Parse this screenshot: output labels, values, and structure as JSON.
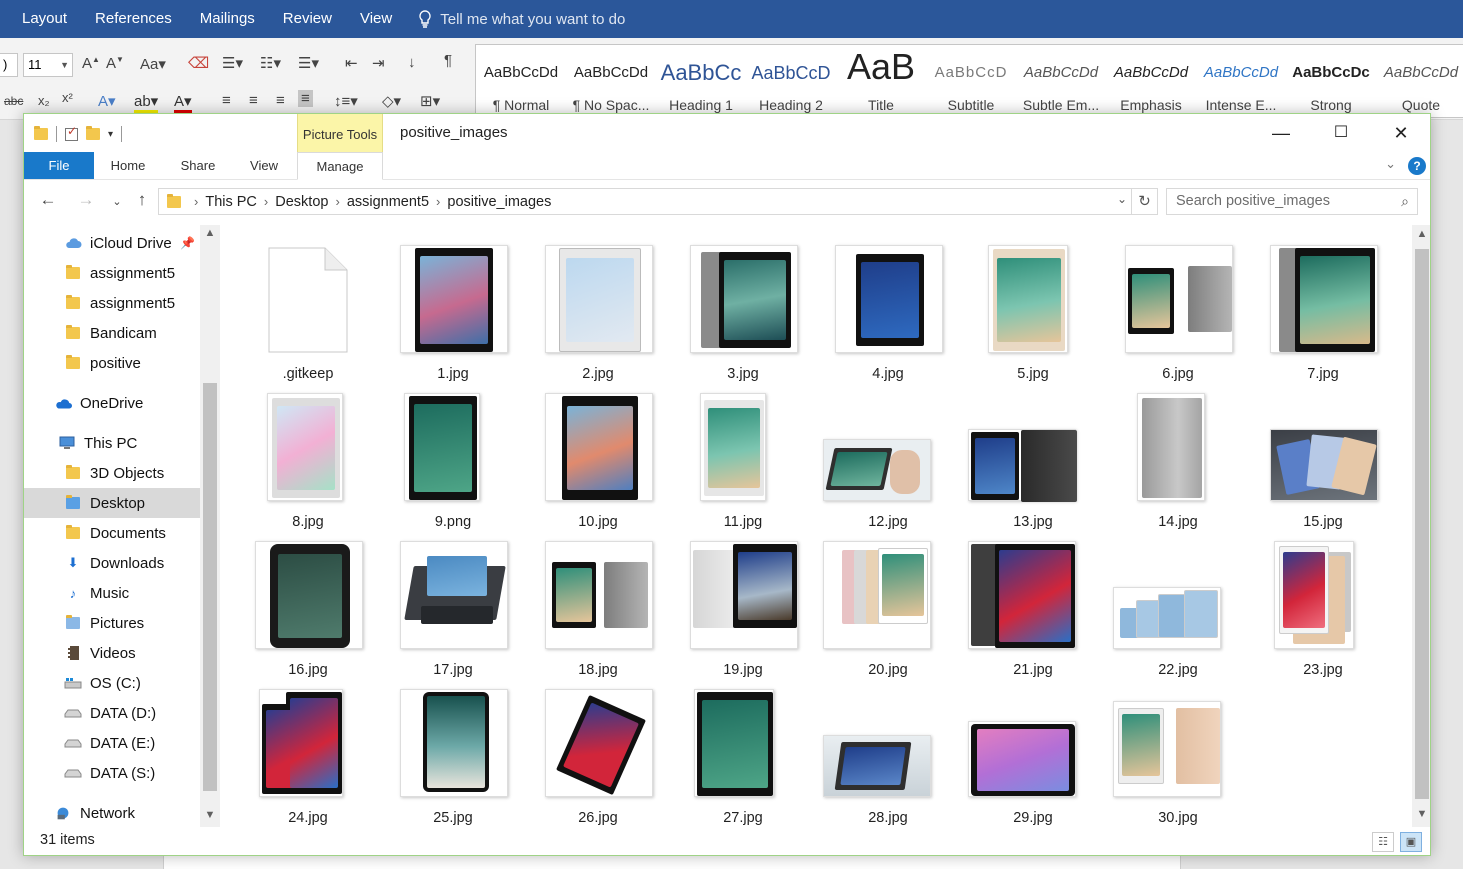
{
  "word": {
    "tabs": [
      "Layout",
      "References",
      "Mailings",
      "Review",
      "View"
    ],
    "tell_me": "Tell me what you want to do",
    "font_name": ")",
    "font_size": "11",
    "styles": [
      {
        "sample": "AaBbCcDd",
        "name": "¶ Normal"
      },
      {
        "sample": "AaBbCcDd",
        "name": "¶ No Spac..."
      },
      {
        "sample": "AaBbCc",
        "name": "Heading 1"
      },
      {
        "sample": "AaBbCcD",
        "name": "Heading 2"
      },
      {
        "sample": "AaB",
        "name": "Title"
      },
      {
        "sample": "AaBbCcD",
        "name": "Subtitle"
      },
      {
        "sample": "AaBbCcDd",
        "name": "Subtle Em..."
      },
      {
        "sample": "AaBbCcDd",
        "name": "Emphasis"
      },
      {
        "sample": "AaBbCcDd",
        "name": "Intense E..."
      },
      {
        "sample": "AaBbCcDc",
        "name": "Strong"
      },
      {
        "sample": "AaBbCcDd",
        "name": "Quote"
      }
    ]
  },
  "explorer": {
    "title": "positive_images",
    "context_tab": "Picture Tools",
    "ribbon_tabs": [
      "File",
      "Home",
      "Share",
      "View",
      "Manage"
    ],
    "window_controls": {
      "minimize": "—",
      "maximize": "☐",
      "close": "✕"
    },
    "breadcrumb": [
      "This PC",
      "Desktop",
      "assignment5",
      "positive_images"
    ],
    "search_placeholder": "Search positive_images",
    "sidebar": [
      {
        "label": "iCloud Drive",
        "icon": "cloud-icon",
        "pinned": true
      },
      {
        "label": "assignment5",
        "icon": "folder-icon"
      },
      {
        "label": "assignment5",
        "icon": "folder-icon"
      },
      {
        "label": "Bandicam",
        "icon": "folder-icon"
      },
      {
        "label": "positive",
        "icon": "folder-icon"
      },
      {
        "label": "OneDrive",
        "icon": "onedrive-icon"
      },
      {
        "label": "This PC",
        "icon": "computer-icon"
      },
      {
        "label": "3D Objects",
        "icon": "3d-objects-icon"
      },
      {
        "label": "Desktop",
        "icon": "desktop-folder-icon",
        "selected": true
      },
      {
        "label": "Documents",
        "icon": "documents-icon"
      },
      {
        "label": "Downloads",
        "icon": "downloads-icon"
      },
      {
        "label": "Music",
        "icon": "music-icon"
      },
      {
        "label": "Pictures",
        "icon": "pictures-icon"
      },
      {
        "label": "Videos",
        "icon": "videos-icon"
      },
      {
        "label": "OS (C:)",
        "icon": "windows-drive-icon"
      },
      {
        "label": "DATA (D:)",
        "icon": "drive-icon"
      },
      {
        "label": "DATA (E:)",
        "icon": "drive-icon"
      },
      {
        "label": "DATA (S:)",
        "icon": "drive-icon"
      },
      {
        "label": "Network",
        "icon": "network-icon"
      }
    ],
    "files": [
      ".gitkeep",
      "1.jpg",
      "2.jpg",
      "3.jpg",
      "4.jpg",
      "5.jpg",
      "6.jpg",
      "7.jpg",
      "8.jpg",
      "9.png",
      "10.jpg",
      "11.jpg",
      "12.jpg",
      "13.jpg",
      "14.jpg",
      "15.jpg",
      "16.jpg",
      "17.jpg",
      "18.jpg",
      "19.jpg",
      "20.jpg",
      "21.jpg",
      "22.jpg",
      "23.jpg",
      "24.jpg",
      "25.jpg",
      "26.jpg",
      "27.jpg",
      "28.jpg",
      "29.jpg",
      "30.jpg"
    ],
    "status": "31 items",
    "colors": {
      "file_tab": "#1979ca",
      "context_tab": "#fbf5a8",
      "word_blue": "#2b579a",
      "window_border": "#9fd386"
    }
  }
}
